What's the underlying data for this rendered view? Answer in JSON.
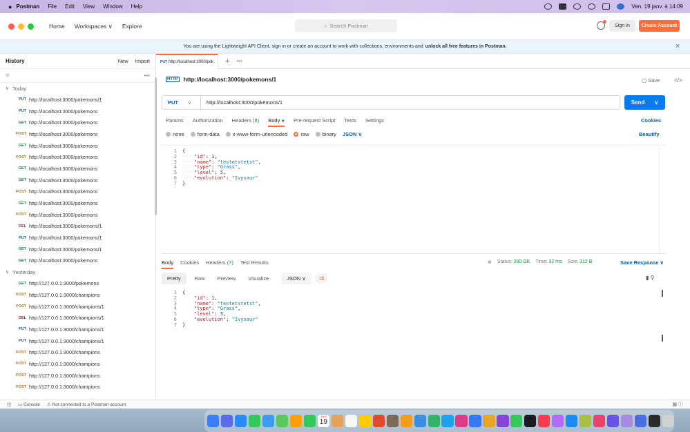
{
  "menubar": {
    "app": "Postman",
    "items": [
      "File",
      "Edit",
      "View",
      "Window",
      "Help"
    ],
    "clock": "Ven. 19 janv. à 14:09"
  },
  "header": {
    "nav": [
      "Home",
      "Workspaces ∨",
      "Explore"
    ],
    "search_placeholder": "Search Postman",
    "sign_in": "Sign In",
    "create_account": "Create Account"
  },
  "banner": {
    "text": "You are using the Lightweight API Client, sign in or create an account to work with collections, environments and",
    "bold": "unlock all free features in Postman.",
    "close": "×"
  },
  "sidebar": {
    "title": "History",
    "new_label": "New",
    "import_label": "Import",
    "groups": [
      {
        "label": "Today",
        "items": [
          {
            "method": "PUT",
            "url": "http://localhost:3000/pokemons/1"
          },
          {
            "method": "PUT",
            "url": "http://localhost:3000/pokemons"
          },
          {
            "method": "GET",
            "url": "http://localhost:3000/pokemons"
          },
          {
            "method": "POST",
            "url": "http://localhost:3000/pokemons"
          },
          {
            "method": "GET",
            "url": "http://localhost:3000/pokemons"
          },
          {
            "method": "POST",
            "url": "http://localhost:3000/pokemons"
          },
          {
            "method": "GET",
            "url": "http://localhost:3000/pokemons"
          },
          {
            "method": "GET",
            "url": "http://localhost:3000/pokemons"
          },
          {
            "method": "POST",
            "url": "http://localhost:3000/pokemons"
          },
          {
            "method": "GET",
            "url": "http://localhost:3000/pokemons"
          },
          {
            "method": "POST",
            "url": "http://localhost:3000/pokemons"
          },
          {
            "method": "DEL",
            "url": "http://localhost:3000/pokemons/1"
          },
          {
            "method": "PUT",
            "url": "http://localhost:3000/pokemons/1"
          },
          {
            "method": "GET",
            "url": "http://localhost:3000/pokemons/1"
          },
          {
            "method": "GET",
            "url": "http://localhost:3000/pokemons"
          }
        ]
      },
      {
        "label": "Yesterday",
        "items": [
          {
            "method": "GET",
            "url": "http://127.0.0.1:3000/pokemons"
          },
          {
            "method": "POST",
            "url": "http://127.0.0.1:3000/champions"
          },
          {
            "method": "POST",
            "url": "http://127.0.0.1:3000/champions/1"
          },
          {
            "method": "DEL",
            "url": "http://127.0.0.1:3000/champions/1"
          },
          {
            "method": "PUT",
            "url": "http://127.0.0.1:3000/champions/1"
          },
          {
            "method": "PUT",
            "url": "http://127.0.0.1:3000/champions/1"
          },
          {
            "method": "POST",
            "url": "http://127.0.0.1:3000/champions"
          },
          {
            "method": "POST",
            "url": "http://127.0.0.1:3000/champions"
          },
          {
            "method": "POST",
            "url": "http://127.0.0.1:3000/champions"
          },
          {
            "method": "POST",
            "url": "http://127.0.0.1:3000/champions"
          }
        ]
      }
    ]
  },
  "tab": {
    "method": "PUT",
    "label": "http://localhost:3000/pok"
  },
  "request": {
    "title": "http://localhost:3000/pokemons/1",
    "save_label": "Save",
    "method": "PUT",
    "url": "http://localhost:3000/pokemons/1",
    "send_label": "Send",
    "tabs": [
      "Params",
      "Authorization",
      "Headers (8)",
      "Body",
      "Pre-request Script",
      "Tests",
      "Settings"
    ],
    "cookies_label": "Cookies",
    "body_options": [
      "none",
      "form-data",
      "x-www-form-urlencoded",
      "raw",
      "binary"
    ],
    "body_format": "JSON",
    "beautify_label": "Beautify",
    "body_lines": [
      [
        {
          "t": "{",
          "c": "p"
        }
      ],
      [
        {
          "t": "····",
          "c": "guide"
        },
        {
          "t": "\"id\"",
          "c": "k"
        },
        {
          "t": ": ",
          "c": "p"
        },
        {
          "t": "1",
          "c": "n"
        },
        {
          "t": ",",
          "c": "p"
        }
      ],
      [
        {
          "t": "····",
          "c": "guide"
        },
        {
          "t": "\"name\"",
          "c": "k"
        },
        {
          "t": ": ",
          "c": "p"
        },
        {
          "t": "\"testetstetst\"",
          "c": "s"
        },
        {
          "t": ",",
          "c": "p"
        }
      ],
      [
        {
          "t": "····",
          "c": "guide"
        },
        {
          "t": "\"type\"",
          "c": "k"
        },
        {
          "t": ": ",
          "c": "p"
        },
        {
          "t": "\"Grass\"",
          "c": "s"
        },
        {
          "t": ",",
          "c": "p"
        }
      ],
      [
        {
          "t": "····",
          "c": "guide"
        },
        {
          "t": "\"level\"",
          "c": "k"
        },
        {
          "t": ": ",
          "c": "p"
        },
        {
          "t": "5",
          "c": "n"
        },
        {
          "t": ",",
          "c": "p"
        }
      ],
      [
        {
          "t": "····",
          "c": "guide"
        },
        {
          "t": "\"evolution\"",
          "c": "k"
        },
        {
          "t": ": ",
          "c": "p"
        },
        {
          "t": "\"Ivysaur\"",
          "c": "s"
        }
      ],
      [
        {
          "t": "}",
          "c": "p"
        }
      ]
    ]
  },
  "response": {
    "tabs": [
      "Body",
      "Cookies",
      "Headers (7)",
      "Test Results"
    ],
    "status": "Status: 200 OK",
    "time": "Time: 32 ms",
    "size": "Size: 312 B",
    "save_response": "Save Response ∨",
    "view_modes": [
      "Pretty",
      "Raw",
      "Preview",
      "Visualize"
    ],
    "format": "JSON",
    "body_lines": [
      [
        {
          "t": "{",
          "c": "p"
        }
      ],
      [
        {
          "t": "    ",
          "c": "p"
        },
        {
          "t": "\"id\"",
          "c": "k"
        },
        {
          "t": ": ",
          "c": "p"
        },
        {
          "t": "1",
          "c": "n"
        },
        {
          "t": ",",
          "c": "p"
        }
      ],
      [
        {
          "t": "    ",
          "c": "p"
        },
        {
          "t": "\"name\"",
          "c": "k"
        },
        {
          "t": ": ",
          "c": "p"
        },
        {
          "t": "\"testetstetst\"",
          "c": "s"
        },
        {
          "t": ",",
          "c": "p"
        }
      ],
      [
        {
          "t": "    ",
          "c": "p"
        },
        {
          "t": "\"type\"",
          "c": "k"
        },
        {
          "t": ": ",
          "c": "p"
        },
        {
          "t": "\"Grass\"",
          "c": "s"
        },
        {
          "t": ",",
          "c": "p"
        }
      ],
      [
        {
          "t": "    ",
          "c": "p"
        },
        {
          "t": "\"level\"",
          "c": "k"
        },
        {
          "t": ": ",
          "c": "p"
        },
        {
          "t": "5",
          "c": "n"
        },
        {
          "t": ",",
          "c": "p"
        }
      ],
      [
        {
          "t": "    ",
          "c": "p"
        },
        {
          "t": "\"evolution\"",
          "c": "k"
        },
        {
          "t": ": ",
          "c": "p"
        },
        {
          "t": "\"Ivysaur\"",
          "c": "s"
        }
      ],
      [
        {
          "t": "}",
          "c": "p"
        }
      ]
    ]
  },
  "footer": {
    "console": "Console",
    "status": "Not connected to a Postman account"
  },
  "dock": {
    "calendar_month": "JANV",
    "calendar_day": "19",
    "apps": [
      "#3b7ef6",
      "#5b6be6",
      "#2a8af7",
      "#34c759",
      "#3d9bf0",
      "#5ac85a",
      "#ff9f0a",
      "#34c759",
      "#e94b3c",
      "#e2a35b",
      "#f6f6f6",
      "#ffcc00",
      "#e04b2b",
      "#7b6a5a",
      "#f29c1f",
      "#3a8de0",
      "#33b36b",
      "#1fa1f2",
      "#dd3a8a",
      "#3478f6",
      "#e9a52a",
      "#8a44d8",
      "#34c759",
      "#1c1c1e",
      "#fa3b4f",
      "#b56af7",
      "#1b8cf7",
      "#a7c03d",
      "#e9456c",
      "#6a52e6",
      "#a78be0",
      "#4a6de6",
      "#2a2a2a",
      "#d0d0d0"
    ]
  }
}
